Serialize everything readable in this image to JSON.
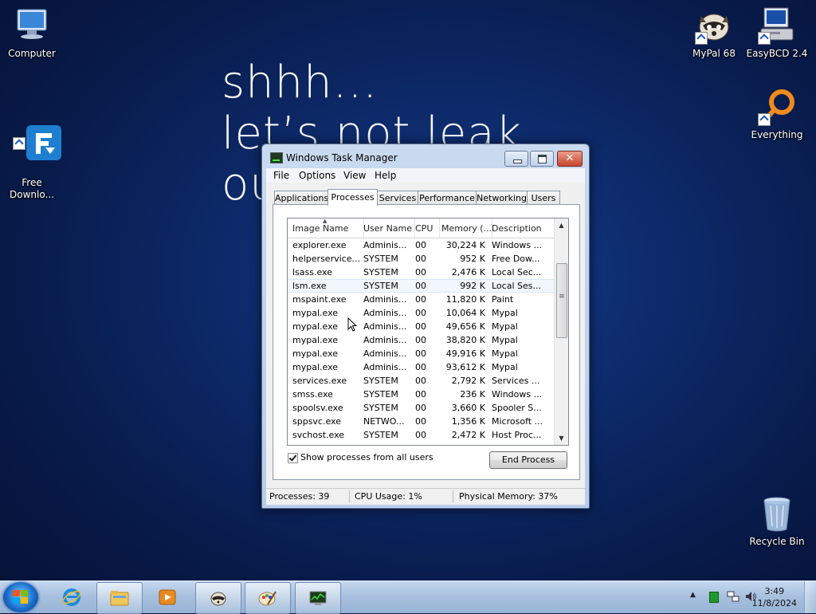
{
  "wallpaper": {
    "text": "shhh...\nlet’s not leak\nou"
  },
  "desktop_icons": {
    "computer": "Computer",
    "free_download": "Free\nDownlo...",
    "mypal": "MyPal 68",
    "easybcd": "EasyBCD 2.4",
    "everything": "Everything",
    "recycle_bin": "Recycle Bin"
  },
  "task_manager": {
    "title": "Windows Task Manager",
    "menu": [
      "File",
      "Options",
      "View",
      "Help"
    ],
    "tabs": [
      "Applications",
      "Processes",
      "Services",
      "Performance",
      "Networking",
      "Users"
    ],
    "active_tab": "Processes",
    "columns": [
      "Image Name",
      "User Name",
      "CPU",
      "Memory (...",
      "Description"
    ],
    "rows": [
      {
        "image": "explorer.exe",
        "user": "Adminis...",
        "cpu": "00",
        "mem": "30,224 K",
        "desc": "Windows ..."
      },
      {
        "image": "helperservice....",
        "user": "SYSTEM",
        "cpu": "00",
        "mem": "952 K",
        "desc": "Free Dow..."
      },
      {
        "image": "lsass.exe",
        "user": "SYSTEM",
        "cpu": "00",
        "mem": "2,476 K",
        "desc": "Local Sec..."
      },
      {
        "image": "lsm.exe",
        "user": "SYSTEM",
        "cpu": "00",
        "mem": "992 K",
        "desc": "Local Ses..."
      },
      {
        "image": "mspaint.exe",
        "user": "Adminis...",
        "cpu": "00",
        "mem": "11,820 K",
        "desc": "Paint"
      },
      {
        "image": "mypal.exe",
        "user": "Adminis...",
        "cpu": "00",
        "mem": "10,064 K",
        "desc": "Mypal"
      },
      {
        "image": "mypal.exe",
        "user": "Adminis...",
        "cpu": "00",
        "mem": "49,656 K",
        "desc": "Mypal"
      },
      {
        "image": "mypal.exe",
        "user": "Adminis...",
        "cpu": "00",
        "mem": "38,820 K",
        "desc": "Mypal"
      },
      {
        "image": "mypal.exe",
        "user": "Adminis...",
        "cpu": "00",
        "mem": "49,916 K",
        "desc": "Mypal"
      },
      {
        "image": "mypal.exe",
        "user": "Adminis...",
        "cpu": "00",
        "mem": "93,612 K",
        "desc": "Mypal"
      },
      {
        "image": "services.exe",
        "user": "SYSTEM",
        "cpu": "00",
        "mem": "2,792 K",
        "desc": "Services ..."
      },
      {
        "image": "smss.exe",
        "user": "SYSTEM",
        "cpu": "00",
        "mem": "236 K",
        "desc": "Windows ..."
      },
      {
        "image": "spoolsv.exe",
        "user": "SYSTEM",
        "cpu": "00",
        "mem": "3,660 K",
        "desc": "Spooler S..."
      },
      {
        "image": "sppsvc.exe",
        "user": "NETWO...",
        "cpu": "00",
        "mem": "1,356 K",
        "desc": "Microsoft ..."
      },
      {
        "image": "svchost.exe",
        "user": "SYSTEM",
        "cpu": "00",
        "mem": "2,472 K",
        "desc": "Host Proc..."
      }
    ],
    "highlighted_row": "lsm.exe",
    "show_all_users": {
      "label": "Show processes from all users",
      "checked": true
    },
    "end_process_label": "End Process",
    "status": {
      "processes": "Processes: 39",
      "cpu_usage": "CPU Usage: 1%",
      "physical_memory": "Physical Memory: 37%"
    }
  },
  "taskbar": {
    "clock_time": "3:49",
    "clock_date": "11/8/2024",
    "pinned": [
      "internet-explorer",
      "windows-explorer",
      "media-player",
      "mypal",
      "paint",
      "task-manager"
    ]
  },
  "colors": {
    "wallpaper": "#0d2a6a",
    "titlebar": "#c9daf0",
    "close_button": "#c9452e",
    "taskbar": "#a7bfdd"
  }
}
